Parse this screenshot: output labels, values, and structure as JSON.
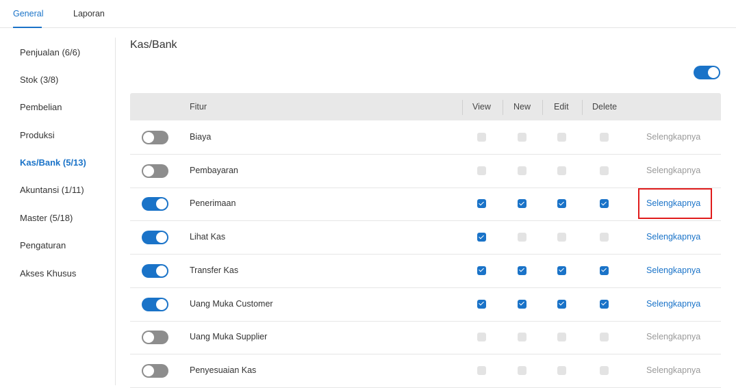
{
  "tabs": [
    {
      "label": "General",
      "active": true
    },
    {
      "label": "Laporan",
      "active": false
    }
  ],
  "sidebar": {
    "items": [
      {
        "label": "Penjualan (6/6)",
        "active": false
      },
      {
        "label": "Stok (3/8)",
        "active": false
      },
      {
        "label": "Pembelian",
        "active": false
      },
      {
        "label": "Produksi",
        "active": false
      },
      {
        "label": "Kas/Bank (5/13)",
        "active": true
      },
      {
        "label": "Akuntansi (1/11)",
        "active": false
      },
      {
        "label": "Master (5/18)",
        "active": false
      },
      {
        "label": "Pengaturan",
        "active": false
      },
      {
        "label": "Akses Khusus",
        "active": false
      }
    ]
  },
  "main": {
    "title": "Kas/Bank",
    "master_toggle_on": true,
    "columns": {
      "fitur": "Fitur",
      "view": "View",
      "new": "New",
      "edit": "Edit",
      "delete": "Delete"
    },
    "rows": [
      {
        "name": "Biaya",
        "enabled": false,
        "view": false,
        "new": false,
        "edit": false,
        "delete": false,
        "link": "Selengkapnya"
      },
      {
        "name": "Pembayaran",
        "enabled": false,
        "view": false,
        "new": false,
        "edit": false,
        "delete": false,
        "link": "Selengkapnya"
      },
      {
        "name": "Penerimaan",
        "enabled": true,
        "view": true,
        "new": true,
        "edit": true,
        "delete": true,
        "link": "Selengkapnya"
      },
      {
        "name": "Lihat Kas",
        "enabled": true,
        "view": true,
        "new": false,
        "edit": false,
        "delete": false,
        "link": "Selengkapnya"
      },
      {
        "name": "Transfer Kas",
        "enabled": true,
        "view": true,
        "new": true,
        "edit": true,
        "delete": true,
        "link": "Selengkapnya"
      },
      {
        "name": "Uang Muka Customer",
        "enabled": true,
        "view": true,
        "new": true,
        "edit": true,
        "delete": true,
        "link": "Selengkapnya"
      },
      {
        "name": "Uang Muka Supplier",
        "enabled": false,
        "view": false,
        "new": false,
        "edit": false,
        "delete": false,
        "link": "Selengkapnya"
      },
      {
        "name": "Penyesuaian Kas",
        "enabled": false,
        "view": false,
        "new": false,
        "edit": false,
        "delete": false,
        "link": "Selengkapnya"
      }
    ]
  },
  "colors": {
    "accent": "#1a73c8",
    "toggle_off": "#8d8d8d",
    "highlight": "#e01b1b"
  }
}
